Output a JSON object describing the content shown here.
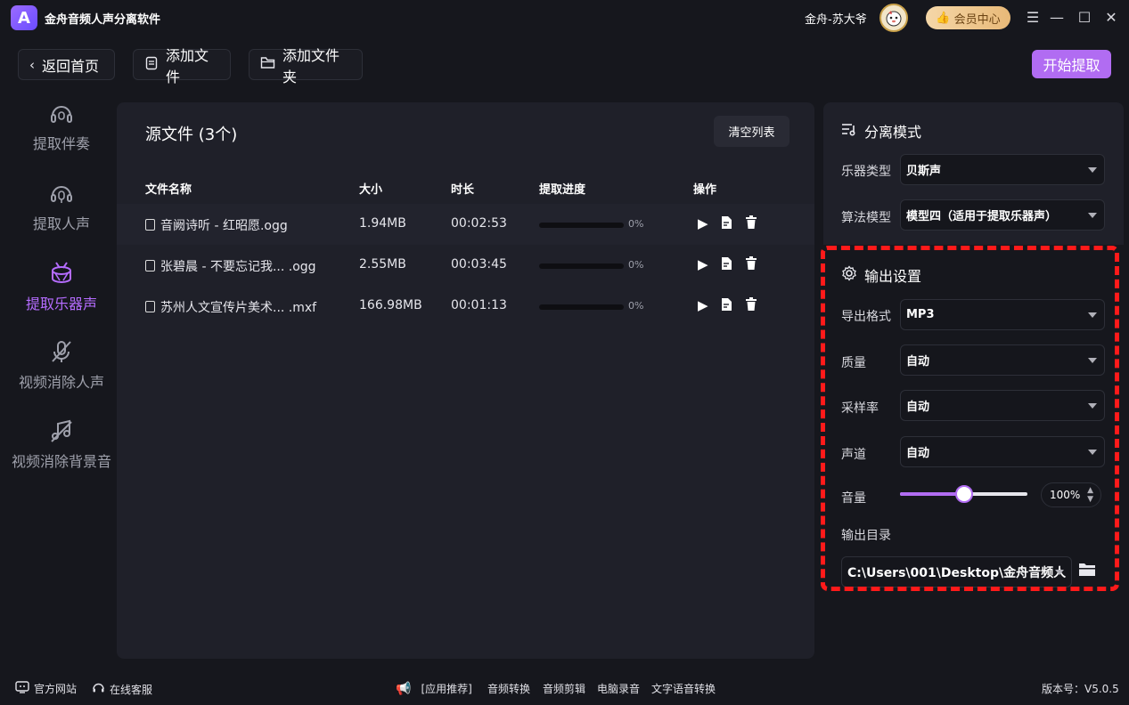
{
  "app": {
    "title": "金舟音频人声分离软件",
    "logo_letter": "A",
    "username": "金舟-苏大爷",
    "vip_label": "会员中心",
    "window_controls": [
      "menu-icon",
      "minimize-icon",
      "maximize-icon",
      "close-icon"
    ]
  },
  "toolbar": {
    "back_label": "返回首页",
    "add_file_label": "添加文件",
    "add_folder_label": "添加文件夹",
    "start_label": "开始提取"
  },
  "sidebar": {
    "items": [
      {
        "label": "提取伴奏",
        "icon": "headphone-icon",
        "active": false
      },
      {
        "label": "提取人声",
        "icon": "headset-mic-icon",
        "active": false
      },
      {
        "label": "提取乐器声",
        "icon": "drum-icon",
        "active": true
      },
      {
        "label": "视频消除人声",
        "icon": "mic-off-icon",
        "active": false
      },
      {
        "label": "视频消除背景音",
        "icon": "music-off-icon",
        "active": false
      }
    ]
  },
  "files": {
    "title": "源文件 (3个)",
    "clear_label": "清空列表",
    "columns": [
      "文件名称",
      "大小",
      "时长",
      "提取进度",
      "操作"
    ],
    "rows": [
      {
        "name": "音阙诗听 - 红昭愿.ogg",
        "size": "1.94MB",
        "duration": "00:02:53",
        "progress": "0%"
      },
      {
        "name": "张碧晨 - 不要忘记我... .ogg",
        "size": "2.55MB",
        "duration": "00:03:45",
        "progress": "0%"
      },
      {
        "name": "苏州人文宣传片美术... .mxf",
        "size": "166.98MB",
        "duration": "00:01:13",
        "progress": "0%"
      }
    ]
  },
  "separation": {
    "title": "分离模式",
    "instrument_label": "乐器类型",
    "instrument_value": "贝斯声",
    "model_label": "算法模型",
    "model_value": "模型四（适用于提取乐器声）"
  },
  "output": {
    "title": "输出设置",
    "format_label": "导出格式",
    "format_value": "MP3",
    "quality_label": "质量",
    "quality_value": "自动",
    "samplerate_label": "采样率",
    "samplerate_value": "自动",
    "channel_label": "声道",
    "channel_value": "自动",
    "volume_label": "音量",
    "volume_value": "100%",
    "volume_level": 0.5,
    "dir_label": "输出目录",
    "dir_value": "C:\\Users\\001\\Desktop\\金舟音频人"
  },
  "footer": {
    "website": "官方网站",
    "support": "在线客服",
    "recommend": "[应用推荐]",
    "links": [
      "音频转换",
      "音频剪辑",
      "电脑录音",
      "文字语音转换"
    ],
    "version": "版本号：V5.0.5"
  },
  "colors": {
    "accent": "#b16cf2",
    "highlight_border": "#ff1a1a",
    "background": "#16171d",
    "panel": "#1f2029"
  }
}
